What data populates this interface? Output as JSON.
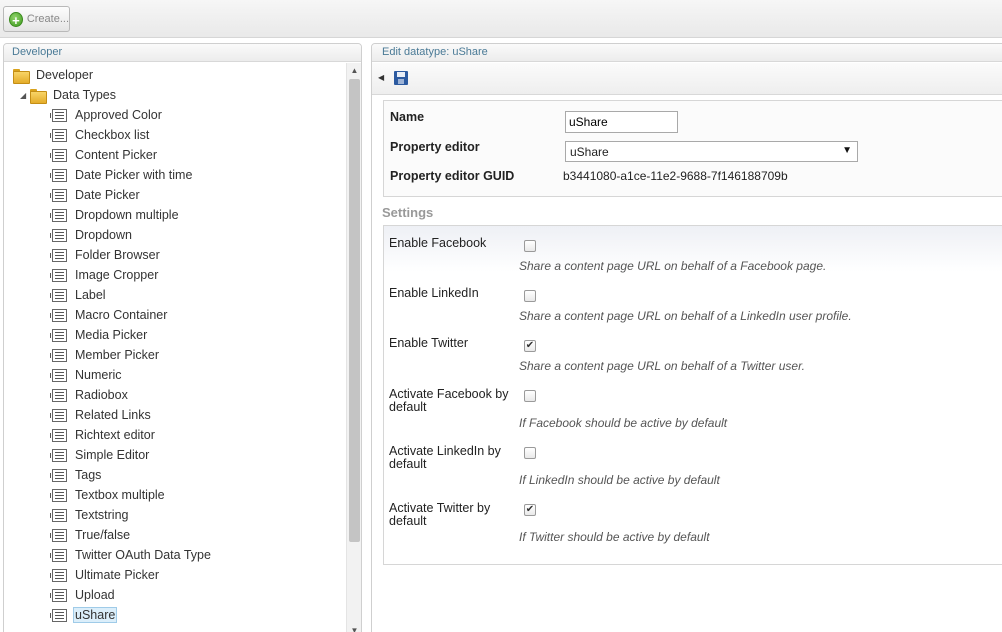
{
  "toolbar": {
    "create_label": "Create..."
  },
  "left_panel": {
    "header": "Developer",
    "root": "Developer",
    "folder": "Data Types",
    "items": [
      "Approved Color",
      "Checkbox list",
      "Content Picker",
      "Date Picker with time",
      "Date Picker",
      "Dropdown multiple",
      "Dropdown",
      "Folder Browser",
      "Image Cropper",
      "Label",
      "Macro Container",
      "Media Picker",
      "Member Picker",
      "Numeric",
      "Radiobox",
      "Related Links",
      "Richtext editor",
      "Simple Editor",
      "Tags",
      "Textbox multiple",
      "Textstring",
      "True/false",
      "Twitter OAuth Data Type",
      "Ultimate Picker",
      "Upload",
      "uShare"
    ],
    "selected_item": "uShare"
  },
  "right_panel": {
    "header": "Edit datatype: uShare",
    "name_label": "Name",
    "name_value": "uShare",
    "property_editor_label": "Property editor",
    "property_editor_value": "uShare",
    "guid_label": "Property editor GUID",
    "guid_value": "b3441080-a1ce-11e2-9688-7f146188709b",
    "settings_title": "Settings",
    "settings": [
      {
        "label": "Enable Facebook",
        "checked": false,
        "description": "Share a content page URL on behalf of a Facebook page."
      },
      {
        "label": "Enable LinkedIn",
        "checked": false,
        "description": "Share a content page URL on behalf of a LinkedIn user profile."
      },
      {
        "label": "Enable Twitter",
        "checked": true,
        "description": "Share a content page URL on behalf of a Twitter user."
      },
      {
        "label": "Activate Facebook by default",
        "checked": false,
        "description": "If Facebook should be active by default"
      },
      {
        "label": "Activate LinkedIn by default",
        "checked": false,
        "description": "If LinkedIn should be active by default"
      },
      {
        "label": "Activate Twitter by default",
        "checked": true,
        "description": "If Twitter should be active by default"
      }
    ]
  },
  "icons": {
    "create": "plus-circle-icon",
    "folder": "folder-icon",
    "datatype": "datatype-icon",
    "save": "save-icon",
    "back": "arrow-left-icon",
    "check": "✔"
  }
}
